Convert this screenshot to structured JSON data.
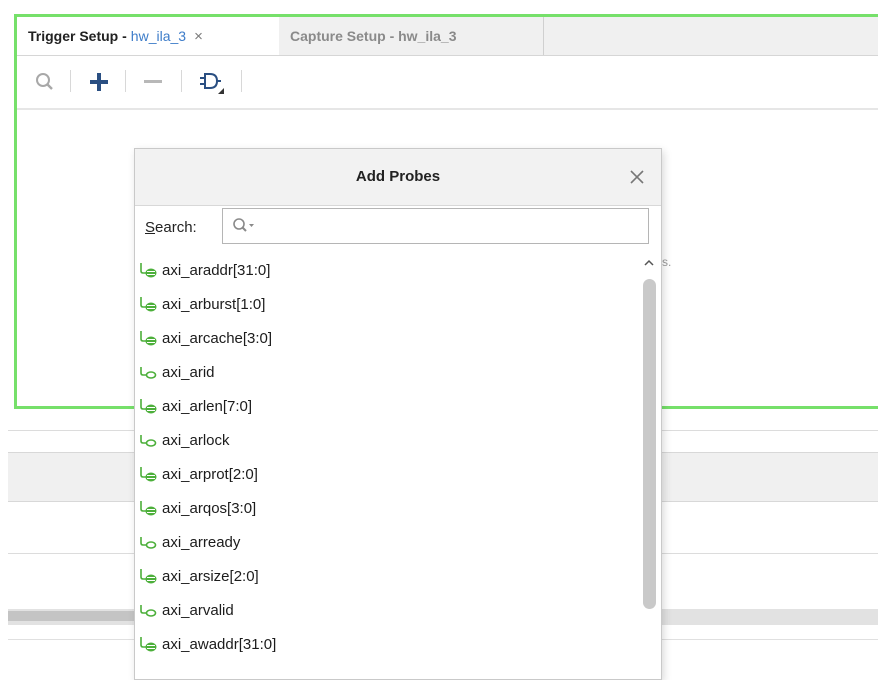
{
  "tabs": {
    "trigger_label": "Trigger Setup -",
    "trigger_suffix": "hw_ila_3",
    "trigger_close": "×",
    "capture_label": "Capture Setup - hw_ila_3"
  },
  "toolbar": {
    "icons": [
      "search-icon",
      "add-icon",
      "remove-icon",
      "gate-icon"
    ]
  },
  "background": {
    "hint_fragment": "s."
  },
  "dialog": {
    "title": "Add Probes",
    "close": "×",
    "search_label_first": "S",
    "search_label_rest": "earch:",
    "search_value": "",
    "probes": [
      {
        "name": "axi_araddr[31:0]",
        "kind": "bus"
      },
      {
        "name": "axi_arburst[1:0]",
        "kind": "bus"
      },
      {
        "name": "axi_arcache[3:0]",
        "kind": "bus"
      },
      {
        "name": "axi_arid",
        "kind": "signal"
      },
      {
        "name": "axi_arlen[7:0]",
        "kind": "bus"
      },
      {
        "name": "axi_arlock",
        "kind": "signal"
      },
      {
        "name": "axi_arprot[2:0]",
        "kind": "bus"
      },
      {
        "name": "axi_arqos[3:0]",
        "kind": "bus"
      },
      {
        "name": "axi_arready",
        "kind": "signal"
      },
      {
        "name": "axi_arsize[2:0]",
        "kind": "bus"
      },
      {
        "name": "axi_arvalid",
        "kind": "signal"
      },
      {
        "name": "axi_awaddr[31:0]",
        "kind": "bus"
      }
    ]
  },
  "colors": {
    "panel_border": "#76e06a",
    "tab_link": "#3d7cc9",
    "probe_icon": "#4caf3a"
  }
}
